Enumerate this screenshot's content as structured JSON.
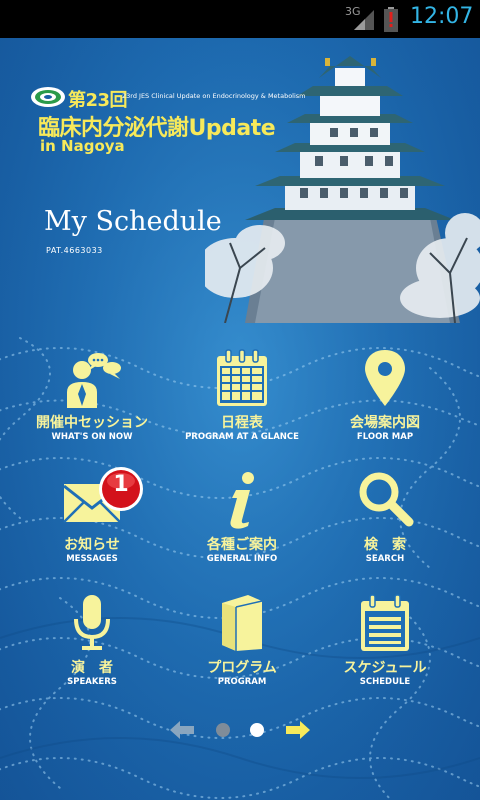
{
  "status_bar": {
    "network": "3G",
    "time": "12:07",
    "icons": [
      "signal-icon",
      "battery-alert-icon"
    ]
  },
  "header": {
    "conference_number": "第23回",
    "conference_subtitle": "23rd JES Clinical Update on Endocrinology & Metabolism",
    "conference_title": "臨床内分泌代謝Update",
    "conference_city": "in Nagoya",
    "page_title": "My Schedule",
    "patent": "PAT.4663033"
  },
  "menu": [
    {
      "id": "whats-on-now",
      "label_ja": "開催中セッション",
      "label_en": "WHAT'S ON NOW",
      "icon": "presenter-chat-icon"
    },
    {
      "id": "program-at-a-glance",
      "label_ja": "日程表",
      "label_en": "PROGRAM AT A GLANCE",
      "icon": "calendar-icon"
    },
    {
      "id": "floor-map",
      "label_ja": "会場案内図",
      "label_en": "FLOOR MAP",
      "icon": "map-pin-icon"
    },
    {
      "id": "messages",
      "label_ja": "お知らせ",
      "label_en": "MESSAGES",
      "icon": "envelope-icon"
    },
    {
      "id": "general-info",
      "label_ja": "各種ご案内",
      "label_en": "GENERAL INFO",
      "icon": "info-icon"
    },
    {
      "id": "search",
      "label_ja": "検　索",
      "label_en": "SEARCH",
      "icon": "magnifier-icon"
    },
    {
      "id": "speakers",
      "label_ja": "演　者",
      "label_en": "SPEAKERS",
      "icon": "microphone-icon"
    },
    {
      "id": "program",
      "label_ja": "プログラム",
      "label_en": "PROGRAM",
      "icon": "book-icon"
    },
    {
      "id": "schedule",
      "label_ja": "スケジュール",
      "label_en": "SCHEDULE",
      "icon": "schedule-list-icon"
    }
  ],
  "messages_badge": "1",
  "pager": {
    "current_page": 2,
    "total_pages": 2,
    "icons": [
      "arrow-left-icon",
      "arrow-right-icon"
    ]
  },
  "colors": {
    "icon_yellow": "#f7f39c",
    "label_yellow": "#f7f39c",
    "background_blue": "#1f6fb6",
    "badge_red": "#d3121b",
    "status_time": "#33b5e5"
  }
}
